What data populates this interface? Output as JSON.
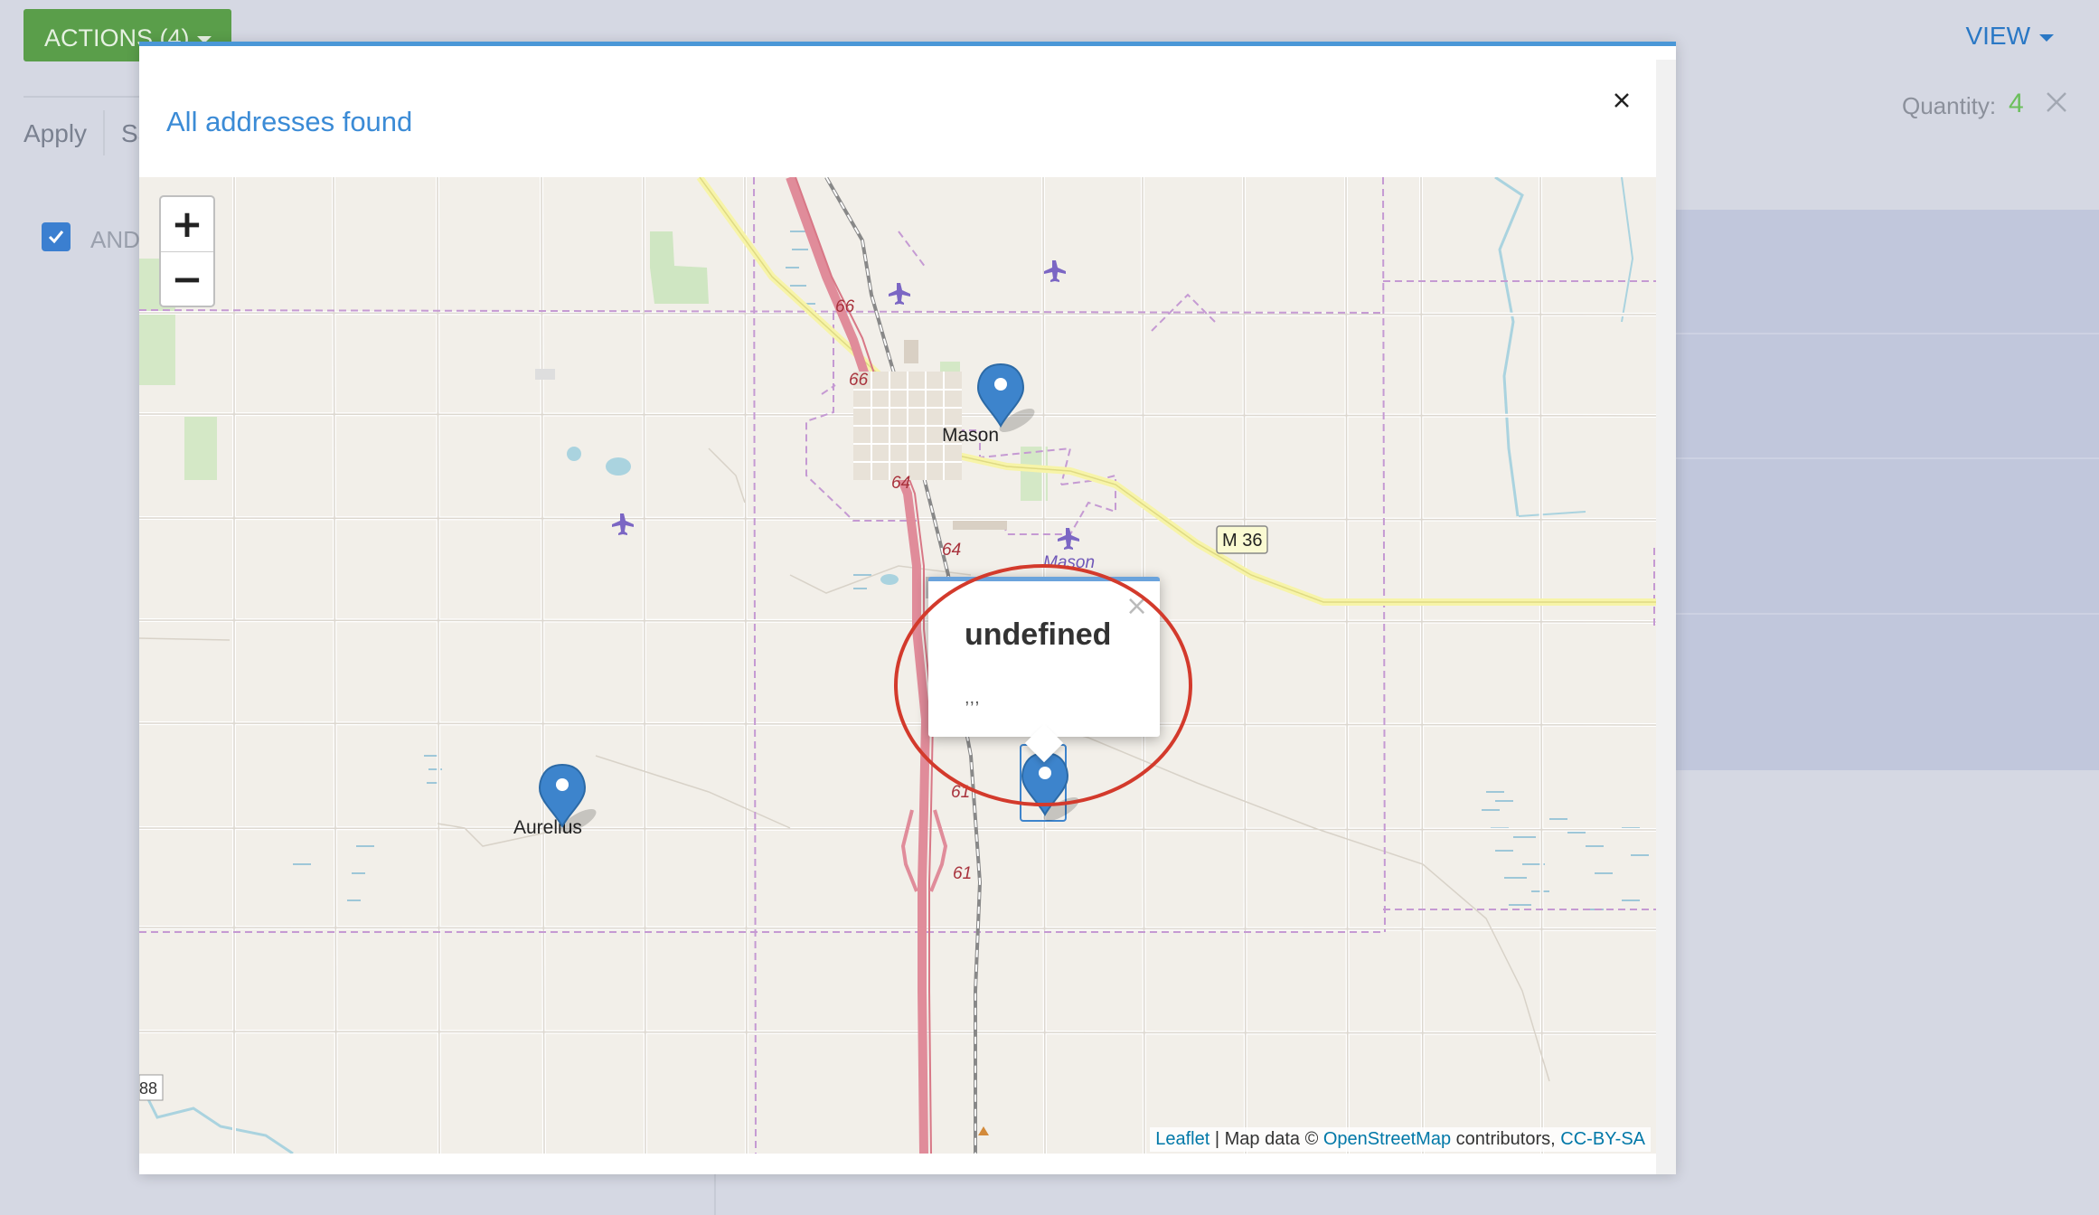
{
  "app": {
    "actions_label": "ACTIONS (4)",
    "view_label": "VIEW",
    "apply_label": "Apply",
    "save_label_partial": "Sa",
    "and_label": "AND",
    "quantity_label": "Quantity:",
    "quantity_value": "4"
  },
  "modal": {
    "title": "All addresses found",
    "close_icon": "close-icon"
  },
  "map": {
    "zoom_in_label": "+",
    "zoom_out_label": "−",
    "places": [
      "Mason",
      "Aurelius"
    ],
    "airport_label": "Mason",
    "highway_shield": "M 36",
    "route_labels": [
      "66",
      "66",
      "64",
      "64",
      "61",
      "61",
      "88"
    ],
    "attribution": {
      "leaflet": "Leaflet",
      "map_data": "| Map data ©",
      "osm": "OpenStreetMap",
      "contributors": "contributors,",
      "license": "CC-BY-SA"
    },
    "marker_count": 4
  },
  "popup": {
    "title": "undefined",
    "body": ",,,",
    "close_label": "×"
  },
  "colors": {
    "accent": "#4a97d7",
    "button_green": "#5a9e4a",
    "marker_blue": "#3d84cc",
    "highlight_red": "#d33a2c"
  }
}
